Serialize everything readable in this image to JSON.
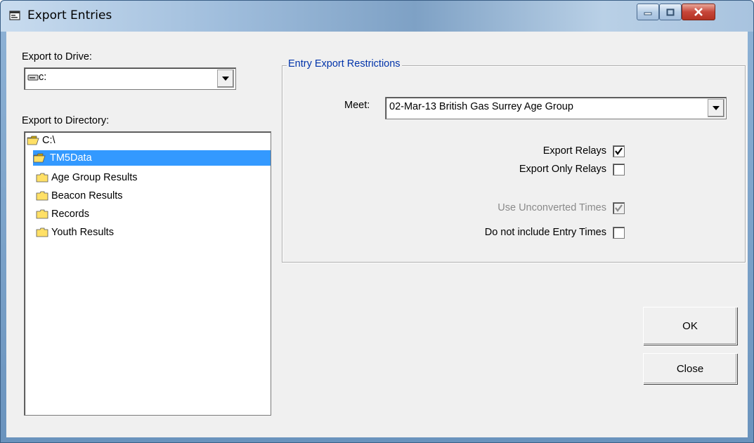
{
  "window": {
    "title": "Export Entries"
  },
  "drive": {
    "label": "Export to Drive:",
    "value": "c:"
  },
  "directory": {
    "label": "Export to Directory:",
    "items": [
      {
        "label": "C:\\",
        "type": "open-folder",
        "selected": false
      },
      {
        "label": "TM5Data",
        "type": "open-folder",
        "selected": true
      },
      {
        "label": "Age Group Results",
        "type": "folder",
        "selected": false
      },
      {
        "label": "Beacon Results",
        "type": "folder",
        "selected": false
      },
      {
        "label": "Records",
        "type": "folder",
        "selected": false
      },
      {
        "label": "Youth Results",
        "type": "folder",
        "selected": false
      }
    ]
  },
  "restrictions": {
    "title": "Entry Export Restrictions",
    "meet_label": "Meet:",
    "meet_value": "02-Mar-13 British Gas Surrey Age Group",
    "options": [
      {
        "label": "Export Relays",
        "checked": true,
        "enabled": true
      },
      {
        "label": "Export Only Relays",
        "checked": false,
        "enabled": true
      },
      {
        "label": "Use Unconverted Times",
        "checked": true,
        "enabled": false
      },
      {
        "label": "Do not include Entry Times",
        "checked": false,
        "enabled": true
      }
    ]
  },
  "buttons": {
    "ok": "OK",
    "close": "Close"
  },
  "colors": {
    "selection": "#3399ff",
    "group_title": "#0033aa",
    "dialog_bg": "#f0f0f0"
  }
}
